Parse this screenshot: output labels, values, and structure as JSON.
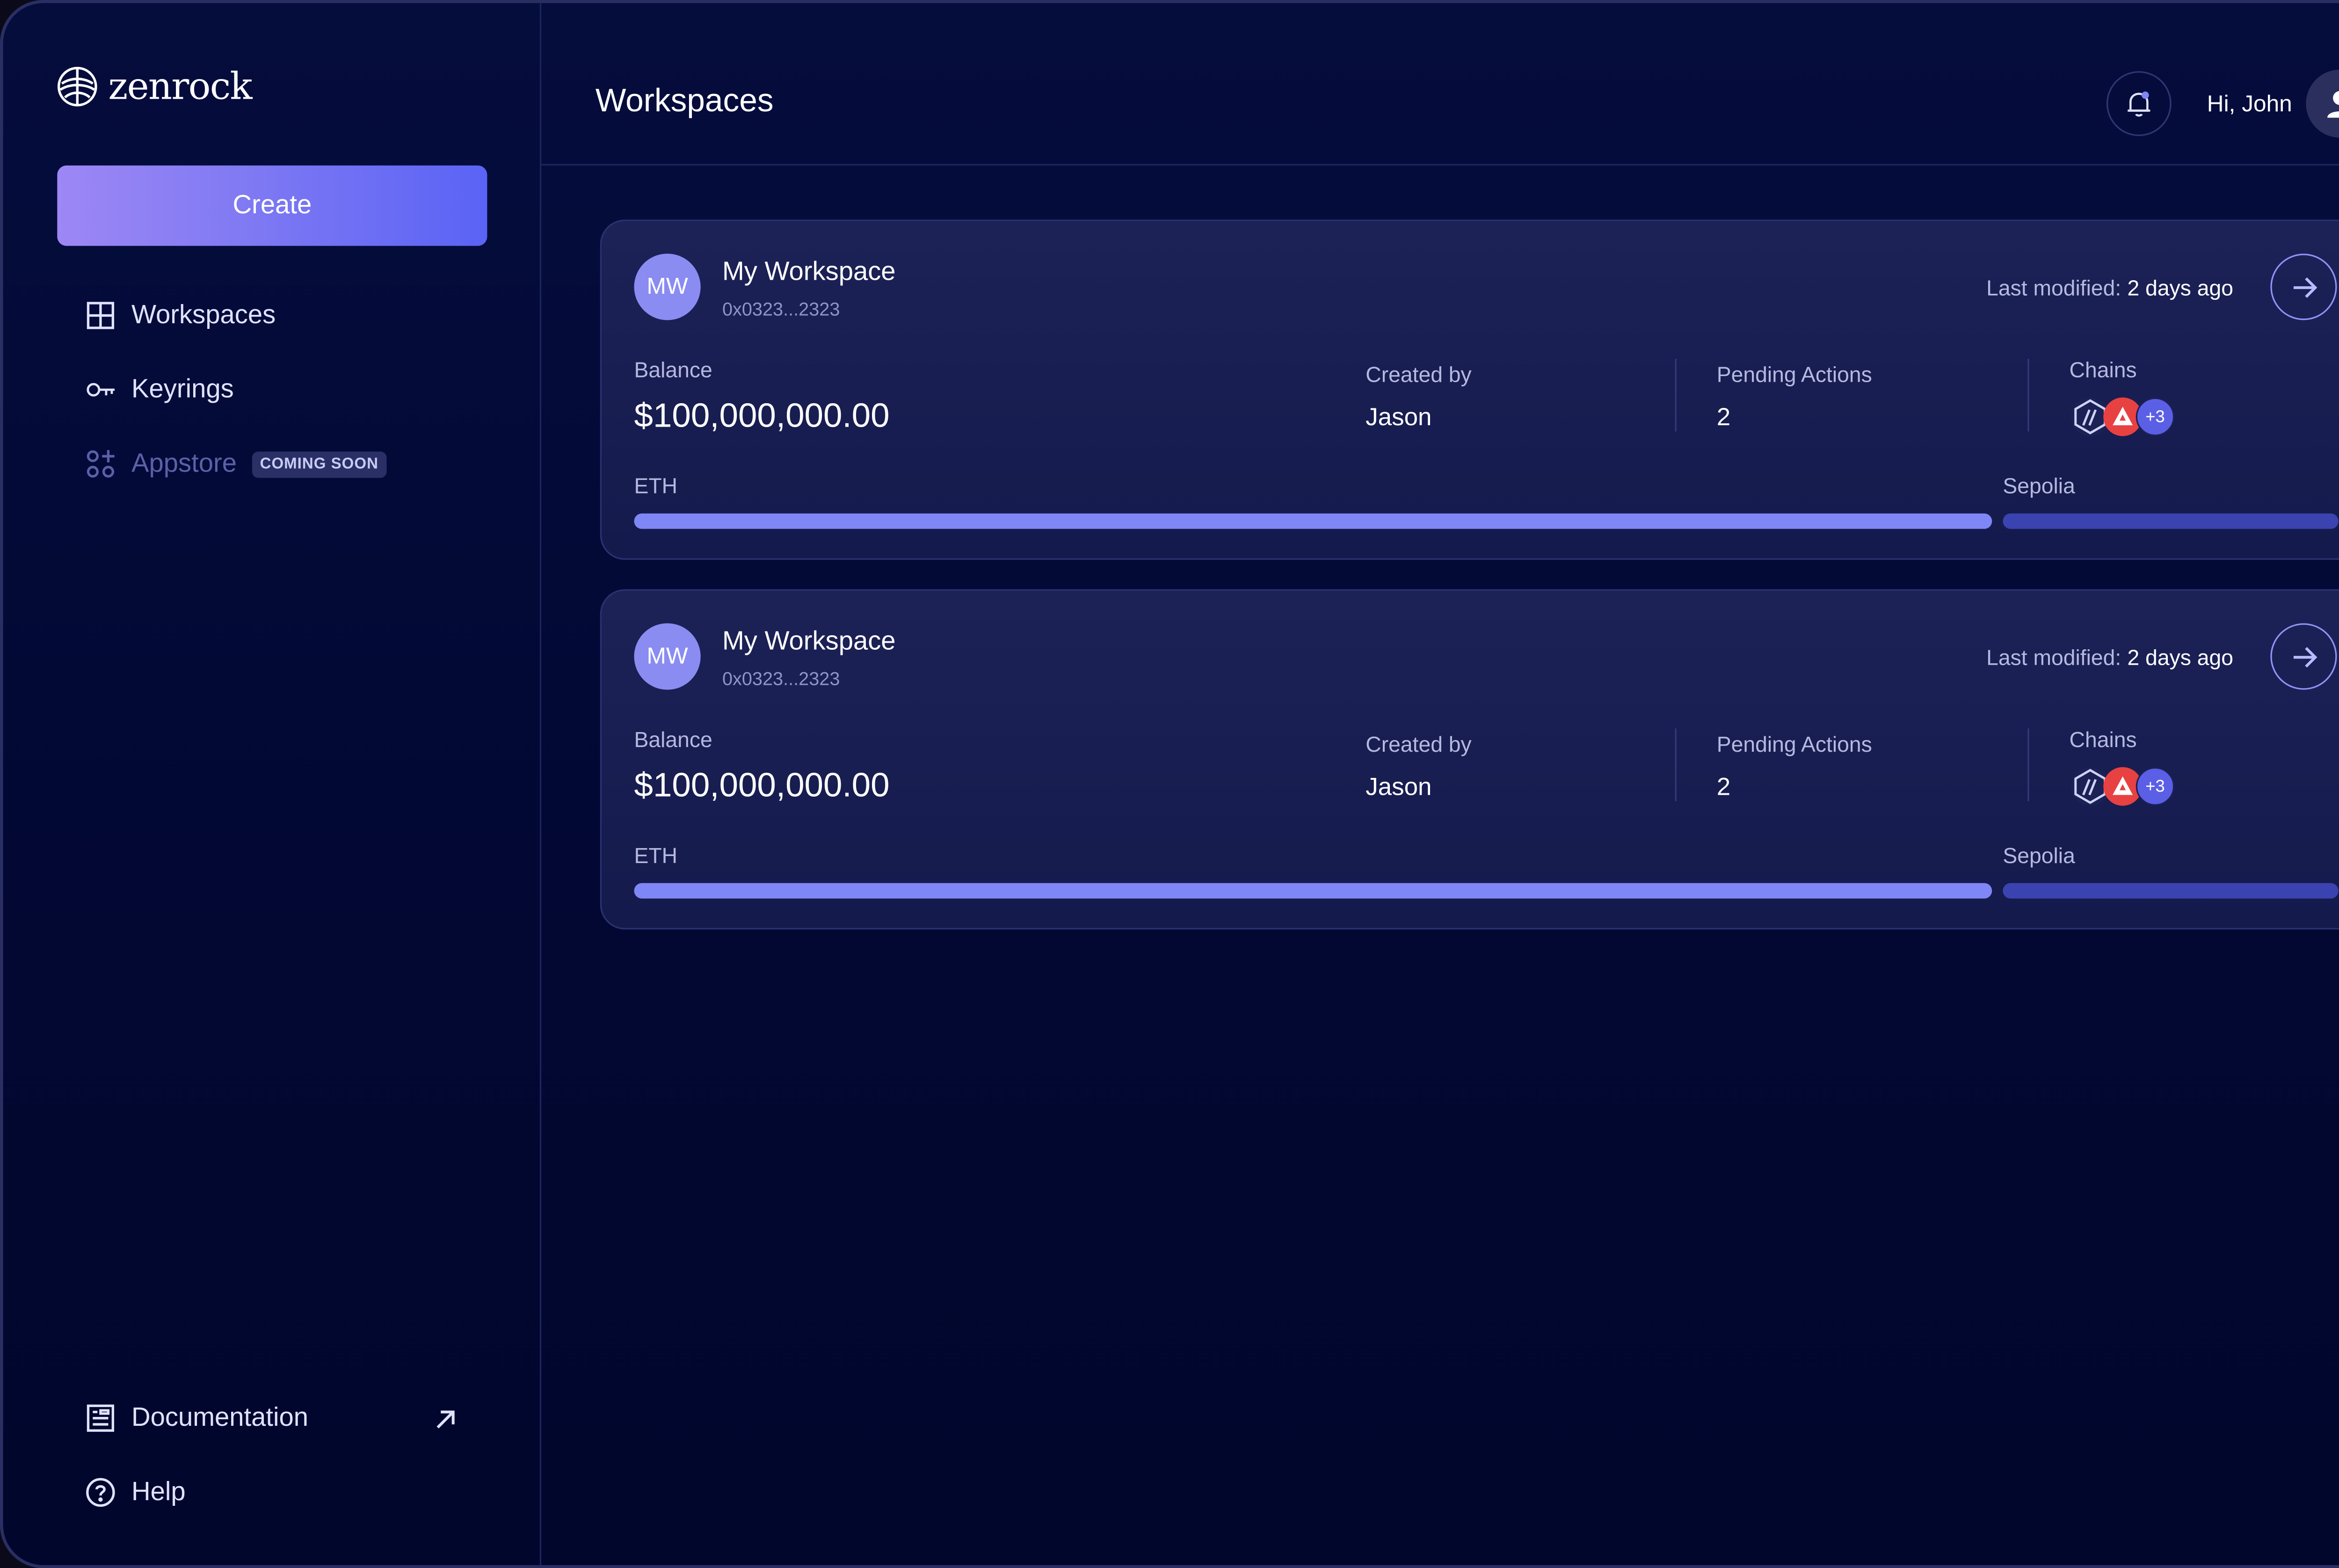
{
  "brand": {
    "name": "zenrock"
  },
  "sidebar": {
    "create_label": "Create",
    "items": [
      {
        "label": "Workspaces",
        "icon": "grid-icon"
      },
      {
        "label": "Keyrings",
        "icon": "key-icon"
      },
      {
        "label": "Appstore",
        "icon": "apps-icon",
        "badge": "COMING SOON",
        "disabled": true
      }
    ],
    "footer": [
      {
        "label": "Documentation",
        "icon": "document-icon",
        "external": true
      },
      {
        "label": "Help",
        "icon": "help-icon"
      }
    ]
  },
  "header": {
    "title": "Workspaces",
    "greeting": "Hi, John"
  },
  "workspaces": [
    {
      "initials": "MW",
      "name": "My Workspace",
      "address": "0x0323...2323",
      "last_modified_label": "Last modified:",
      "last_modified": "2 days ago",
      "balance_label": "Balance",
      "balance": "$100,000,000.00",
      "created_by_label": "Created by",
      "created_by": "Jason",
      "pending_label": "Pending Actions",
      "pending": "2",
      "chains_label": "Chains",
      "chains_more": "+3",
      "bar_left_label": "ETH",
      "bar_right_label": "Sepolia"
    },
    {
      "initials": "MW",
      "name": "My Workspace",
      "address": "0x0323...2323",
      "last_modified_label": "Last modified:",
      "last_modified": "2 days ago",
      "balance_label": "Balance",
      "balance": "$100,000,000.00",
      "created_by_label": "Created by",
      "created_by": "Jason",
      "pending_label": "Pending Actions",
      "pending": "2",
      "chains_label": "Chains",
      "chains_more": "+3",
      "bar_left_label": "ETH",
      "bar_right_label": "Sepolia"
    }
  ],
  "colors": {
    "accent": "#5a63f5",
    "accent_light": "#9d87f5",
    "background": "#020833",
    "card": "#1a2054",
    "bar_primary": "#7f86f5",
    "bar_secondary": "#3b43b0"
  }
}
